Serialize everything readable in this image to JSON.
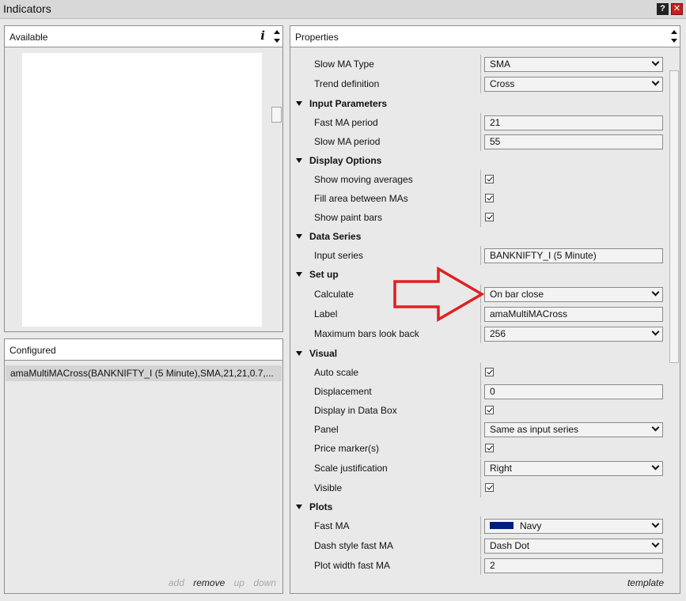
{
  "window": {
    "title": "Indicators",
    "help_glyph": "?",
    "close_glyph": "✕"
  },
  "available": {
    "header": "Available",
    "info_glyph": "i"
  },
  "configured": {
    "header": "Configured",
    "items": [
      "amaMultiMACross(BANKNIFTY_I (5 Minute),SMA,21,21,0.7,..."
    ],
    "footer": {
      "add": "add",
      "remove": "remove",
      "up": "up",
      "down": "down"
    }
  },
  "properties": {
    "header": "Properties",
    "footer": "template",
    "rows": {
      "slow_ma_type": {
        "name": "Slow MA Type",
        "value": "SMA"
      },
      "trend_definition": {
        "name": "Trend definition",
        "value": "Cross"
      },
      "cat_input_parameters": "Input Parameters",
      "fast_ma_period": {
        "name": "Fast MA period",
        "value": "21"
      },
      "slow_ma_period": {
        "name": "Slow MA period",
        "value": "55"
      },
      "cat_display_options": "Display Options",
      "show_moving_averages": {
        "name": "Show moving averages",
        "checked": true
      },
      "fill_area_between": {
        "name": "Fill area between MAs",
        "checked": true
      },
      "show_paint_bars": {
        "name": "Show paint bars",
        "checked": true
      },
      "cat_data_series": "Data Series",
      "input_series": {
        "name": "Input series",
        "value": "BANKNIFTY_I (5 Minute)"
      },
      "cat_set_up": "Set up",
      "calculate": {
        "name": "Calculate",
        "value": "On bar close"
      },
      "label": {
        "name": "Label",
        "value": "amaMultiMACross"
      },
      "max_bars_look_back": {
        "name": "Maximum bars look back",
        "value": "256"
      },
      "cat_visual": "Visual",
      "auto_scale": {
        "name": "Auto scale",
        "checked": true
      },
      "displacement": {
        "name": "Displacement",
        "value": "0"
      },
      "display_in_data_box": {
        "name": "Display in Data Box",
        "checked": true
      },
      "panel": {
        "name": "Panel",
        "value": "Same as input series"
      },
      "price_markers": {
        "name": "Price marker(s)",
        "checked": true
      },
      "scale_justification": {
        "name": "Scale justification",
        "value": "Right"
      },
      "visible": {
        "name": "Visible",
        "checked": true
      },
      "cat_plots": "Plots",
      "fast_ma": {
        "name": "Fast MA",
        "value": "Navy",
        "color": "#001f7a"
      },
      "dash_style_fast_ma": {
        "name": "Dash style fast MA",
        "value": "Dash Dot"
      },
      "plot_width_fast_ma": {
        "name": "Plot width fast MA",
        "value": "2"
      }
    }
  },
  "colors": {
    "arrow": "#e02020",
    "selected_row": "#d4d4d4",
    "close_button": "#c81e1e"
  }
}
